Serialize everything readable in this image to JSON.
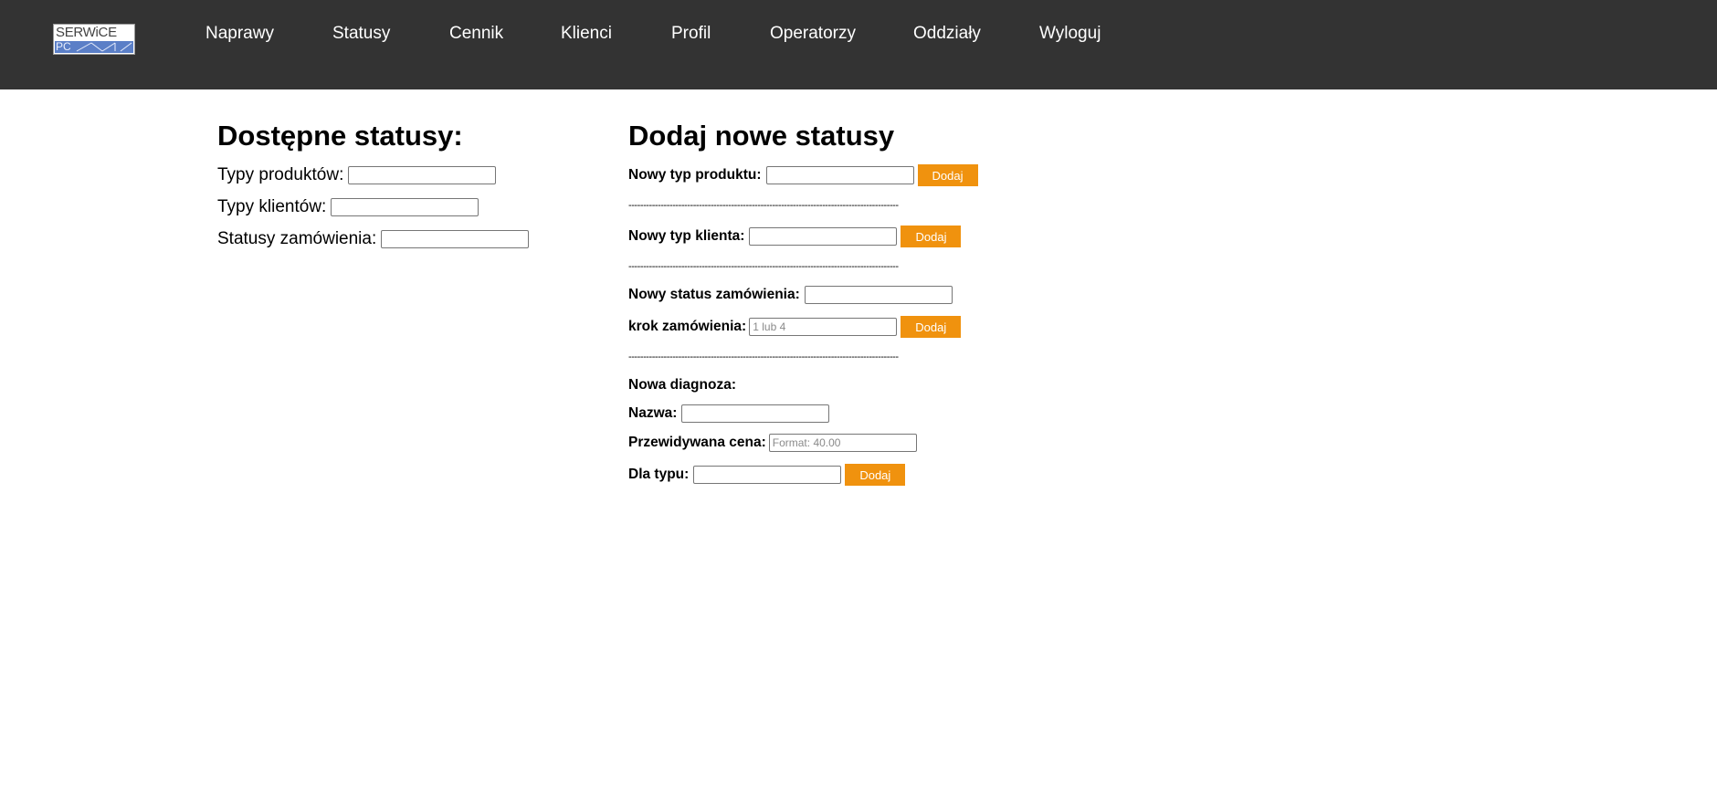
{
  "nav": {
    "logo_top": "SERWiCE",
    "logo_bottom": "PC",
    "items": [
      "Naprawy",
      "Statusy",
      "Cennik",
      "Klienci",
      "Profil",
      "Operatorzy",
      "Oddziały",
      "Wyloguj"
    ]
  },
  "left": {
    "title": "Dostępne statusy:",
    "product_types_label": "Typy produktów:",
    "client_types_label": "Typy klientów:",
    "order_statuses_label": "Statusy zamówienia:"
  },
  "right": {
    "title": "Dodaj nowe statusy",
    "new_product_type_label": "Nowy typ produktu:",
    "new_client_type_label": "Nowy typ klienta:",
    "new_order_status_label": "Nowy status zamówienia:",
    "order_step_label": "krok zamówienia:",
    "order_step_placeholder": "1 lub 4",
    "new_diagnosis_label": "Nowa diagnoza:",
    "name_label": "Nazwa:",
    "price_label": "Przewidywana cena:",
    "price_placeholder": "Format: 40.00",
    "for_type_label": "Dla typu:",
    "add_button": "Dodaj",
    "separator": "--------------------------------------------------------------------------------------------"
  },
  "colors": {
    "navbar": "#333333",
    "button": "#f0920e"
  }
}
